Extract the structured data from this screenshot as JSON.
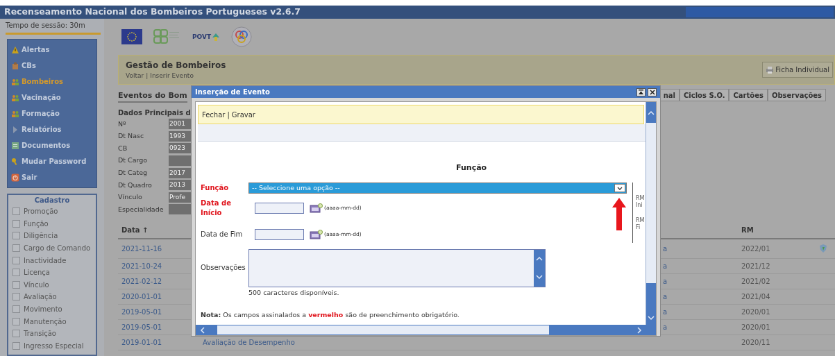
{
  "window": {
    "title": "Recenseamento Nacional dos Bombeiros Portugueses v2.6.7"
  },
  "session": {
    "text": "Tempo de sessão: 30m"
  },
  "menu": [
    {
      "label": "Alertas",
      "selected": false
    },
    {
      "label": "CBs",
      "selected": false
    },
    {
      "label": "Bombeiros",
      "selected": true
    },
    {
      "label": "Vacinação",
      "selected": false
    },
    {
      "label": "Formação",
      "selected": false
    },
    {
      "label": "Relatórios",
      "selected": false
    },
    {
      "label": "Documentos",
      "selected": false
    },
    {
      "label": "Mudar Password",
      "selected": false
    },
    {
      "label": "Sair",
      "selected": false
    }
  ],
  "cadastro": {
    "title": "Cadastro",
    "items": [
      {
        "label": "Promoção",
        "checked": false
      },
      {
        "label": "Função",
        "checked": false
      },
      {
        "label": "Diligência",
        "checked": false
      },
      {
        "label": "Cargo de Comando",
        "checked": false
      },
      {
        "label": "Inactividade",
        "checked": false
      },
      {
        "label": "Licença",
        "checked": false
      },
      {
        "label": "Vínculo",
        "checked": false
      },
      {
        "label": "Avaliação",
        "checked": false
      },
      {
        "label": "Movimento",
        "checked": false
      },
      {
        "label": "Manutenção",
        "checked": false
      },
      {
        "label": "Transição",
        "checked": false
      },
      {
        "label": "Ingresso Especial",
        "checked": false
      }
    ]
  },
  "logos": {
    "povt": "POVT"
  },
  "header": {
    "title": "Gestão de Bombeiros",
    "links": [
      "Voltar",
      "Inserir Evento"
    ],
    "separator": "|",
    "button": "Ficha Individual"
  },
  "events": {
    "heading": "Eventos do Bom",
    "tabs": [
      "nal",
      "Ciclos S.O.",
      "Cartões",
      "Observações"
    ],
    "subheading": "Dados Principais d",
    "details": [
      {
        "label": "Nº",
        "value": "2001"
      },
      {
        "label": "Dt Nasc",
        "value": "1993"
      },
      {
        "label": "CB",
        "value": "0923"
      },
      {
        "label": "Dt Cargo"
      },
      {
        "label": "Dt Categ",
        "value": "2017"
      },
      {
        "label": "Dt Quadro",
        "value": "2013"
      },
      {
        "label": "Vínculo",
        "value": "Profe"
      },
      {
        "label": "Especialidade"
      }
    ]
  },
  "table": {
    "columns": [
      "Data ↑",
      "RM"
    ],
    "rows": [
      {
        "date": "2021-11-16",
        "column_2": "a",
        "rm": "2022/01",
        "shield": true
      },
      {
        "date": "2021-10-24",
        "column_2": "a",
        "rm": "2021/12",
        "shield": false
      },
      {
        "date": "2021-02-12",
        "column_2": "a",
        "rm": "2021/02",
        "shield": false
      },
      {
        "date": "2020-01-01",
        "column_2": "a",
        "rm": "2021/04",
        "shield": false
      },
      {
        "date": "2019-05-01",
        "column_2": "a",
        "rm": "2020/01",
        "shield": false
      },
      {
        "date": "2019-05-01",
        "column_2": "a",
        "rm": "2020/01",
        "shield": false
      },
      {
        "date": "2019-01-01",
        "column_2": "Avaliação de Desempenho",
        "rm": "2020/11",
        "shield": false
      }
    ]
  },
  "dialog": {
    "title": "Inserção de Evento",
    "links": [
      "Fechar",
      "Gravar"
    ],
    "separator": "|",
    "heading": "Função",
    "fields": [
      {
        "kind": "select",
        "label": "Função",
        "required": true,
        "value": "-- Seleccione uma opção --"
      },
      {
        "kind": "date",
        "label": "Data de Início",
        "required": true,
        "hint": "(aaaa-mm-dd)"
      },
      {
        "kind": "date",
        "label": "Data de Fim",
        "required": false,
        "hint": "(aaaa-mm-dd)"
      },
      {
        "kind": "textarea",
        "label": "Observações",
        "required": false,
        "counter": "500 caracteres disponíveis."
      }
    ],
    "side_labels": [
      [
        "RM",
        "Ini"
      ],
      [
        "RM",
        "Fi"
      ]
    ],
    "note": {
      "label": "Nota:",
      "before": "Os campos assinalados a",
      "highlight": "vermelho",
      "after": "são de preenchimento obrigatório."
    }
  }
}
